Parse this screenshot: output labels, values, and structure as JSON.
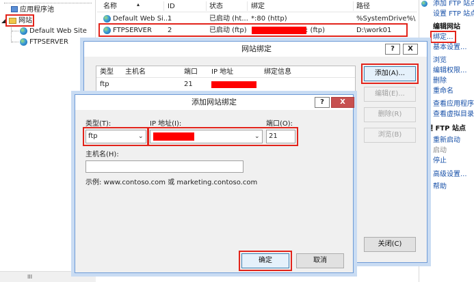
{
  "tree": {
    "app_pools": "应用程序池",
    "sites": "网站",
    "site1": "Default Web Site",
    "site2": "FTPSERVER"
  },
  "sites_table": {
    "headers": [
      "名称",
      "ID",
      "状态",
      "绑定",
      "路径"
    ],
    "rows": [
      {
        "name": "Default Web Si...",
        "id": "1",
        "status": "已启动 (ht...",
        "binding": "*:80 (http)",
        "path": "%SystemDrive%\\"
      },
      {
        "name": "FTPSERVER",
        "id": "2",
        "status": "已启动 (ftp)",
        "binding": ": (ftp)",
        "path": "D:\\work01"
      }
    ]
  },
  "actions": {
    "top1": "添加 FTP 站点",
    "top2": "设置 FTP 站点",
    "edit_site": "编辑网站",
    "bindings": "绑定...",
    "basic": "基本设置...",
    "browse": "浏览",
    "edit_perm": "编辑权限...",
    "delete": "删除",
    "rename": "重命名",
    "view_apps": "查看应用程序",
    "view_vdirs": "查看虚拟目录",
    "manage_ftp": "管理 FTP 站点",
    "restart": "重新启动",
    "start": "启动",
    "stop": "停止",
    "advanced": "高级设置...",
    "help": "帮助"
  },
  "binding_dialog": {
    "title": "网站绑定",
    "help": "?",
    "close": "X",
    "columns": [
      "类型",
      "主机名",
      "端口",
      "IP 地址",
      "绑定信息"
    ],
    "row": {
      "type": "ftp",
      "host": "",
      "port": "21"
    },
    "add": "添加(A)...",
    "edit": "编辑(E)...",
    "remove": "删除(R)",
    "browse": "浏览(B)",
    "close_btn": "关闭(C)"
  },
  "add_dialog": {
    "title": "添加网站绑定",
    "help": "?",
    "close": "X",
    "type_label": "类型(T):",
    "type_value": "ftp",
    "ip_label": "IP 地址(I):",
    "port_label": "端口(O):",
    "port_value": "21",
    "host_label": "主机名(H):",
    "host_value": "",
    "example": "示例: www.contoso.com 或 marketing.contoso.com",
    "ok": "确定",
    "cancel": "取消"
  },
  "scroll": {
    "h_thumb": "III"
  }
}
